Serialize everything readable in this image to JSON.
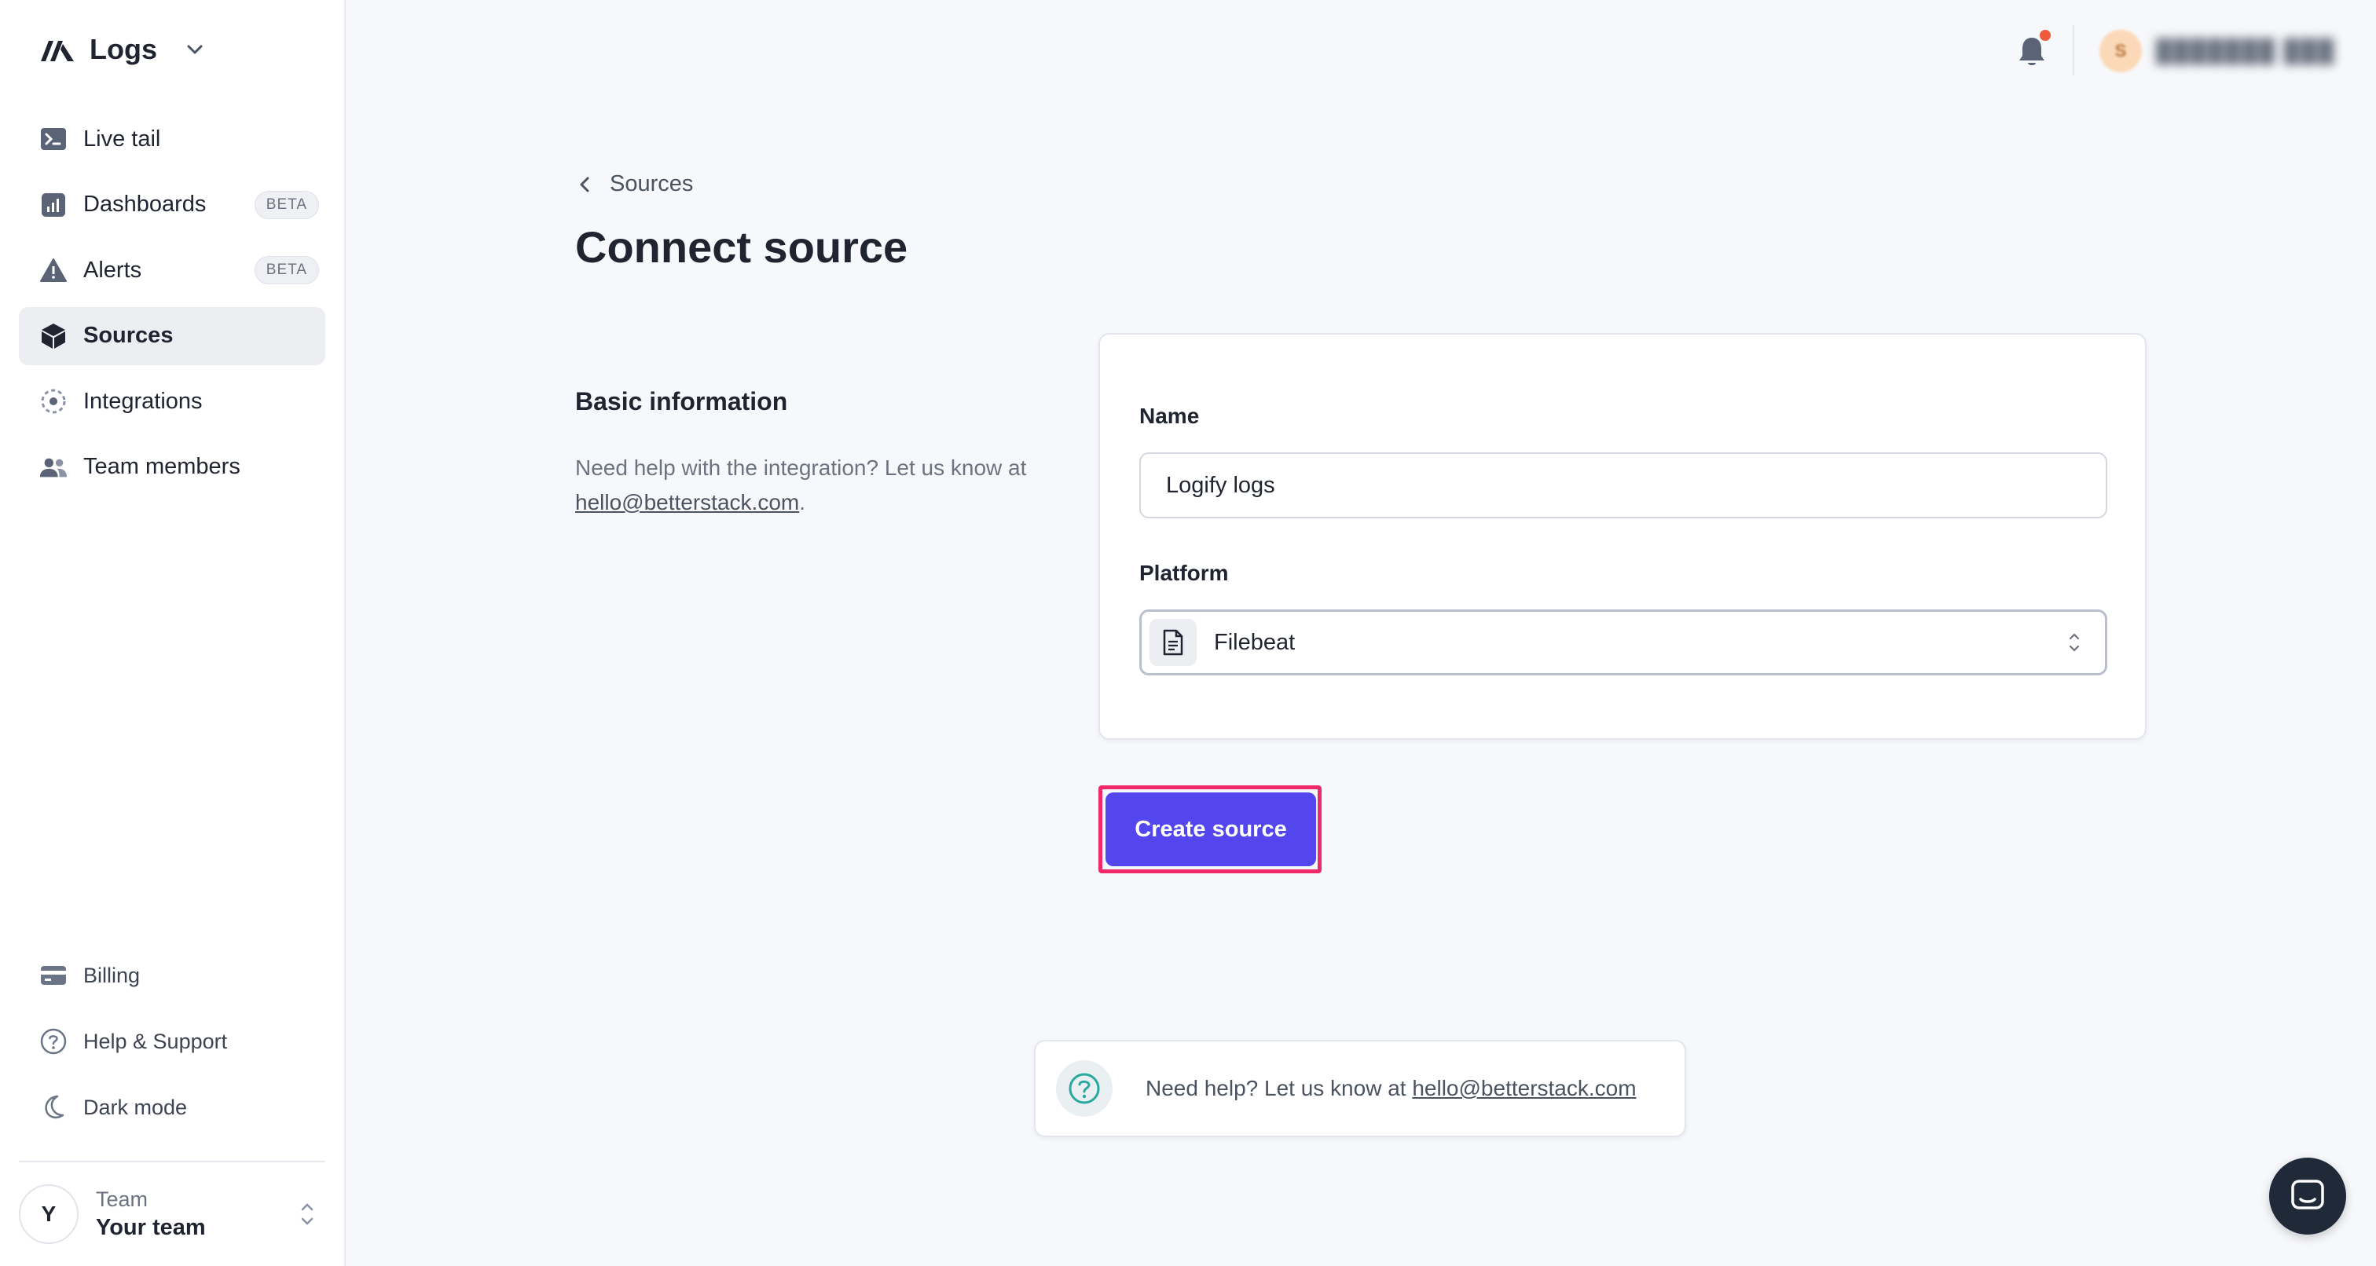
{
  "app": {
    "name": "Logs"
  },
  "sidebar": {
    "items": [
      {
        "label": "Live tail",
        "icon": "terminal-icon"
      },
      {
        "label": "Dashboards",
        "icon": "chart-icon",
        "badge": "BETA"
      },
      {
        "label": "Alerts",
        "icon": "warning-icon",
        "badge": "BETA"
      },
      {
        "label": "Sources",
        "icon": "cube-icon",
        "active": true
      },
      {
        "label": "Integrations",
        "icon": "integrations-icon"
      },
      {
        "label": "Team members",
        "icon": "users-icon"
      }
    ],
    "bottom": [
      {
        "label": "Billing",
        "icon": "card-icon"
      },
      {
        "label": "Help & Support",
        "icon": "help-icon"
      },
      {
        "label": "Dark mode",
        "icon": "moon-icon"
      }
    ],
    "team": {
      "initial": "Y",
      "label": "Team",
      "name": "Your team"
    }
  },
  "topbar": {
    "user_initials": "S"
  },
  "page": {
    "breadcrumb": "Sources",
    "title": "Connect source",
    "section_title": "Basic information",
    "section_desc_prefix": "Need help with the integration? Let us know at ",
    "section_desc_email": "hello@betterstack.com",
    "section_desc_suffix": "."
  },
  "form": {
    "name_label": "Name",
    "name_value": "Logify logs",
    "platform_label": "Platform",
    "platform_value": "Filebeat",
    "submit_label": "Create source"
  },
  "help": {
    "text": "Need help? Let us know at ",
    "email": "hello@betterstack.com"
  },
  "colors": {
    "accent": "#5346ee",
    "highlight": "#ee2a6b",
    "notification": "#ef5a3c"
  }
}
